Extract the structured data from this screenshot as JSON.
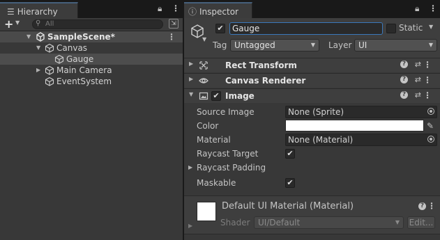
{
  "hierarchy": {
    "tab_title": "Hierarchy",
    "tab_icon": "list-icon",
    "search_placeholder": "All",
    "tree": [
      {
        "label": "SampleScene*",
        "kind": "scene"
      },
      {
        "label": "Canvas",
        "kind": "gameobject"
      },
      {
        "label": "Gauge",
        "kind": "gameobject",
        "selected": true
      },
      {
        "label": "Main Camera",
        "kind": "gameobject"
      },
      {
        "label": "EventSystem",
        "kind": "gameobject"
      }
    ]
  },
  "inspector": {
    "tab_title": "Inspector",
    "tab_icon": "info-icon",
    "gameobject": {
      "active": true,
      "name": "Gauge",
      "static_label": "Static",
      "static_checked": false,
      "tag_label": "Tag",
      "tag_value": "Untagged",
      "layer_label": "Layer",
      "layer_value": "UI"
    },
    "components": [
      {
        "title": "Rect Transform",
        "icon": "rect-transform-icon",
        "expanded": false
      },
      {
        "title": "Canvas Renderer",
        "icon": "eye-icon",
        "expanded": false
      },
      {
        "title": "Image",
        "icon": "image-icon",
        "expanded": true,
        "enabled": true
      }
    ],
    "image_props": {
      "source_image_label": "Source Image",
      "source_image_value": "None (Sprite)",
      "color_label": "Color",
      "color_value": "#ffffff",
      "material_label": "Material",
      "material_value": "None (Material)",
      "raycast_target_label": "Raycast Target",
      "raycast_target": true,
      "raycast_padding_label": "Raycast Padding",
      "maskable_label": "Maskable",
      "maskable": true
    },
    "material": {
      "title": "Default UI Material (Material)",
      "shader_label": "Shader",
      "shader_value": "UI/Default",
      "edit_label": "Edit..."
    }
  }
}
